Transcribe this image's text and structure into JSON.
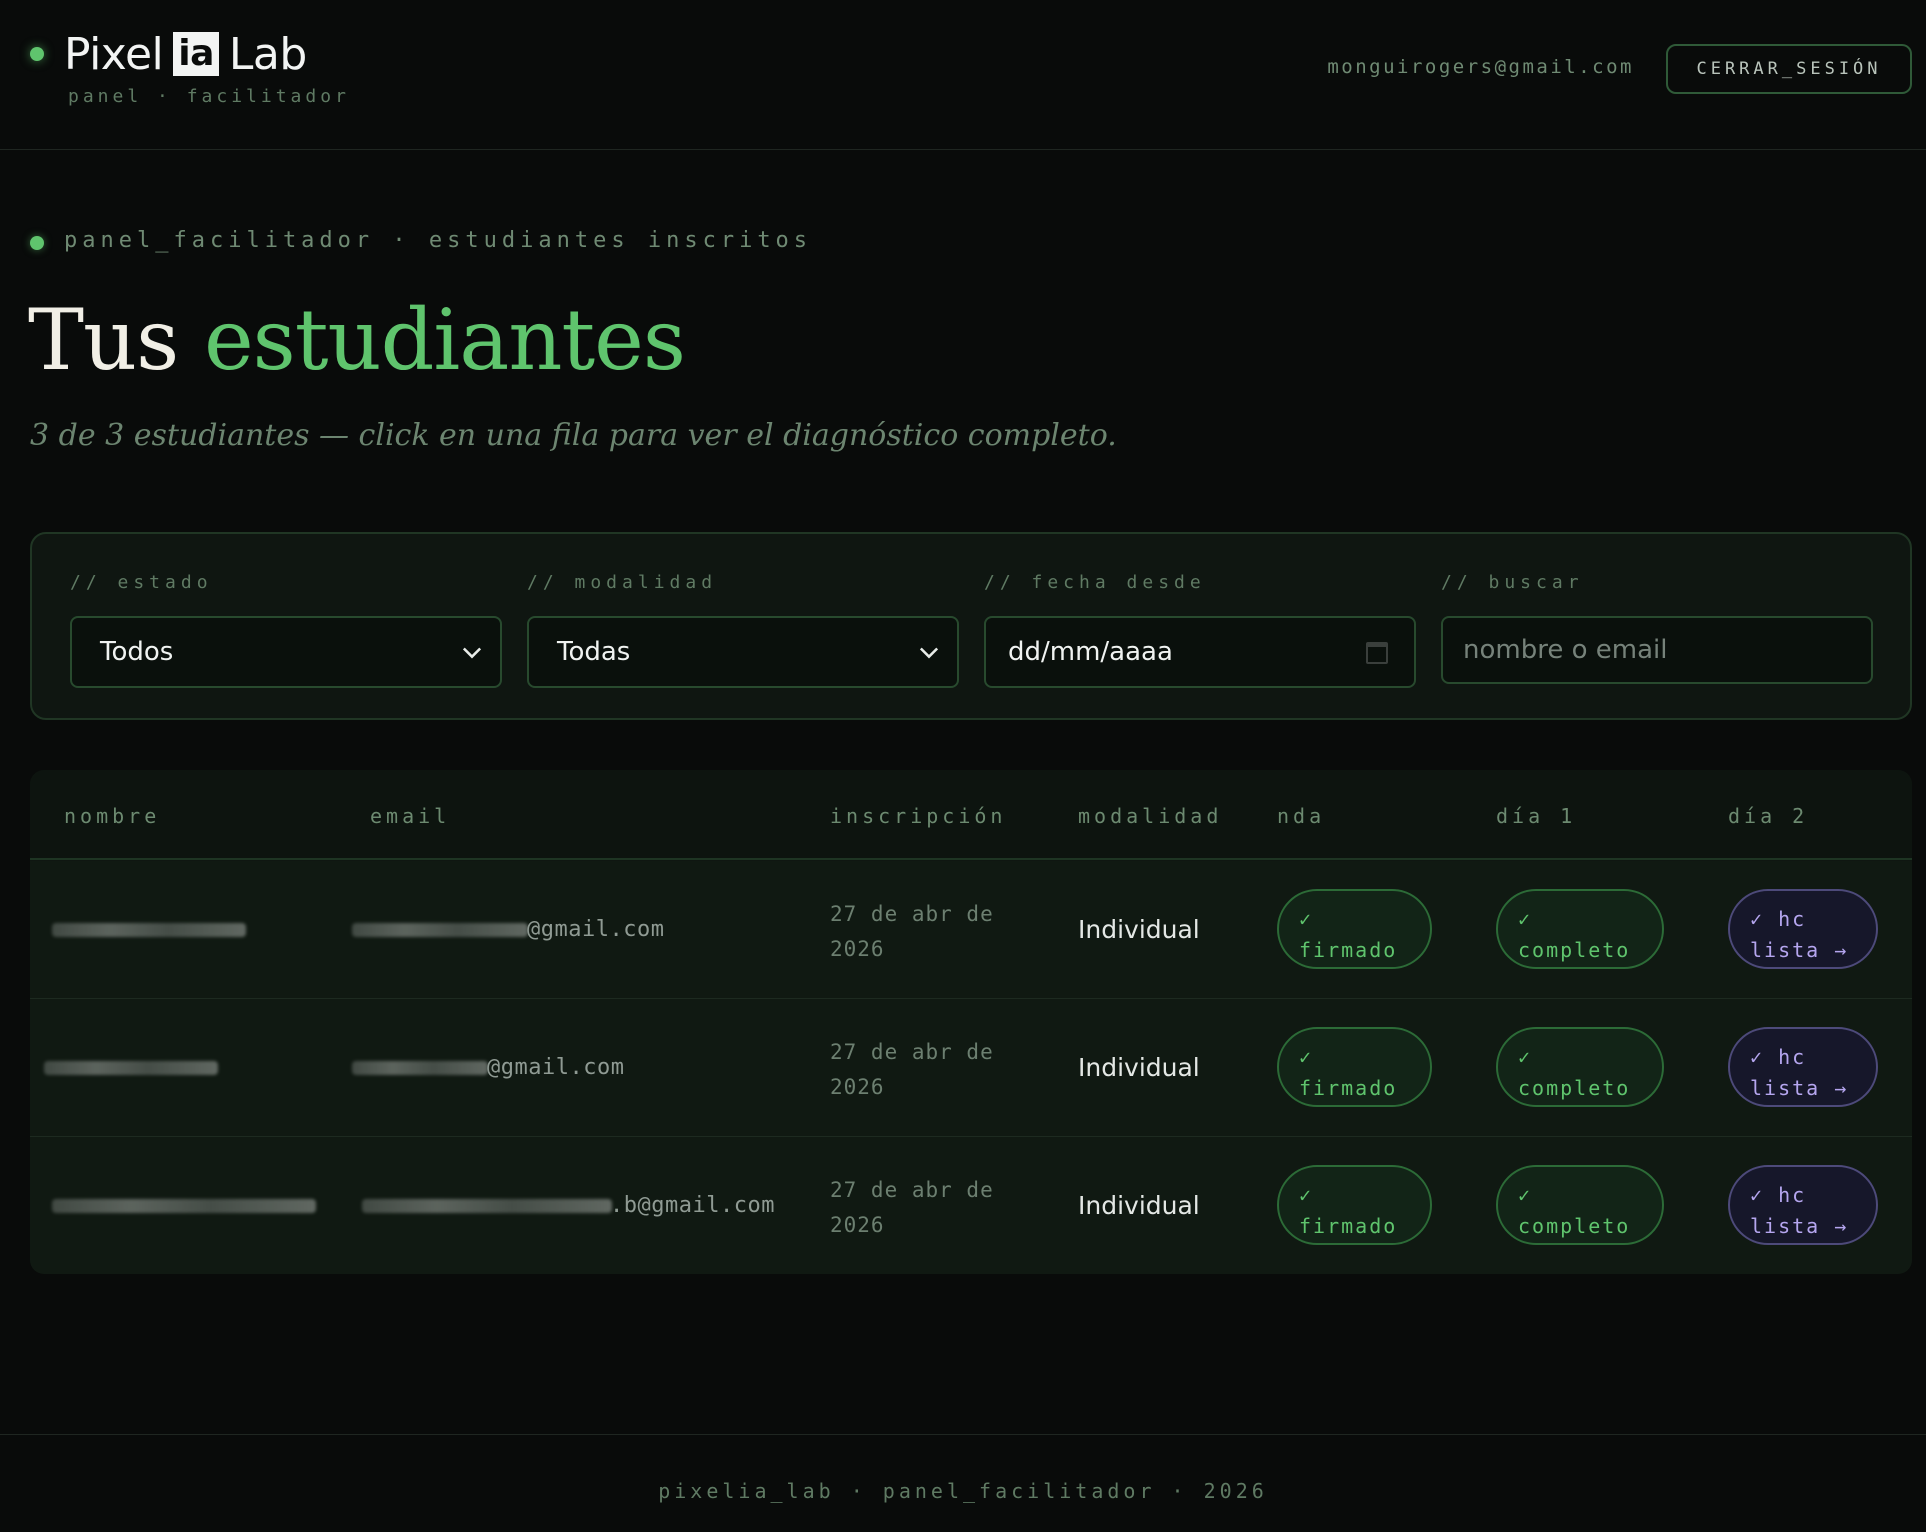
{
  "header": {
    "brand_pre": "Pixel",
    "brand_mid": "ia",
    "brand_post": "Lab",
    "brand_sub": "panel · facilitador",
    "user_email": "monguirogers@gmail.com",
    "logout_label": "CERRAR_SESIÓN"
  },
  "hero": {
    "breadcrumb": "panel_facilitador · estudiantes inscritos",
    "title_plain": "Tus",
    "title_accent": "estudiantes",
    "subtitle": "3 de 3 estudiantes — click en una fila para ver el diagnóstico completo."
  },
  "filters": {
    "estado": {
      "label": "// estado",
      "value": "Todos"
    },
    "modalidad": {
      "label": "// modalidad",
      "value": "Todas"
    },
    "fecha": {
      "label": "// fecha desde",
      "value": "dd/mm/aaaa"
    },
    "buscar": {
      "label": "// buscar",
      "placeholder": "nombre o email"
    }
  },
  "table": {
    "headers": [
      "nombre",
      "email",
      "inscripción",
      "modalidad",
      "nda",
      "día 1",
      "día 2"
    ],
    "rows": [
      {
        "email_suffix": "@gmail.com",
        "date_line1": "27 de abr de",
        "date_line2": "2026",
        "modalidad": "Individual",
        "nda_check": "✓",
        "nda": "firmado",
        "d1_check": "✓",
        "d1": "completo",
        "d2_line1": "✓ hc",
        "d2_line2": "lista →"
      },
      {
        "email_suffix": "@gmail.com",
        "date_line1": "27 de abr de",
        "date_line2": "2026",
        "modalidad": "Individual",
        "nda_check": "✓",
        "nda": "firmado",
        "d1_check": "✓",
        "d1": "completo",
        "d2_line1": "✓ hc",
        "d2_line2": "lista →"
      },
      {
        "email_suffix": ".b@gmail.com",
        "date_line1": "27 de abr de",
        "date_line2": "2026",
        "modalidad": "Individual",
        "nda_check": "✓",
        "nda": "firmado",
        "d1_check": "✓",
        "d1": "completo",
        "d2_line1": "✓ hc",
        "d2_line2": "lista →"
      }
    ]
  },
  "footer": {
    "text": "pixelia_lab · panel_facilitador · 2026"
  },
  "colors": {
    "accent": "#5fc46d",
    "background": "#090b0a",
    "purple": "#b5a6ef"
  }
}
